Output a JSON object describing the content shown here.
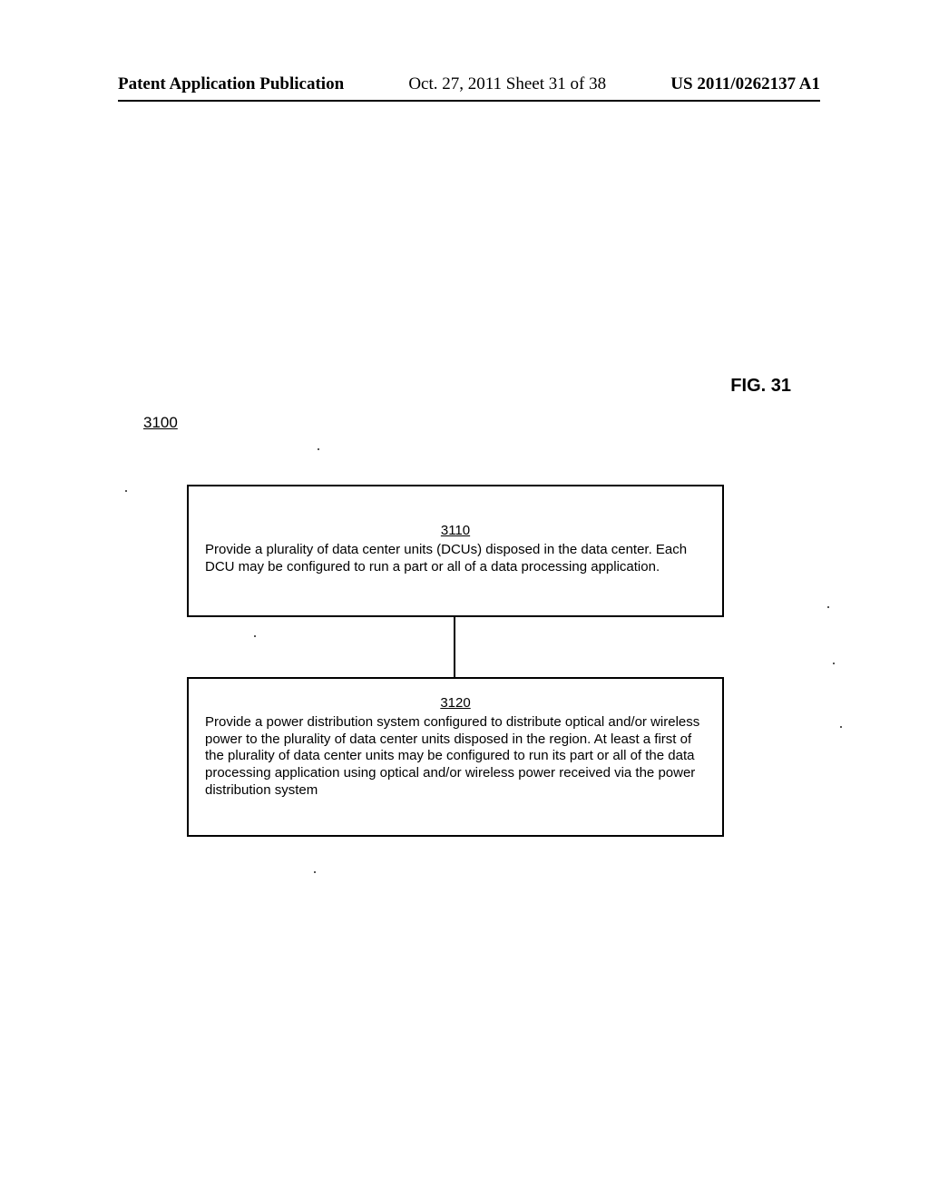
{
  "header": {
    "left": "Patent Application Publication",
    "center": "Oct. 27, 2011  Sheet 31 of 38",
    "right": "US 2011/0262137 A1"
  },
  "figure": {
    "label": "FIG. 31",
    "flowchart_number": "3100",
    "box1": {
      "number": "3110",
      "text": "Provide a plurality of data center units (DCUs) disposed in the  data center.  Each DCU may be configured to run a part or all of a data processing application."
    },
    "box2": {
      "number": "3120",
      "text": "Provide a power distribution system configured to distribute optical and/or wireless power to the plurality of data center units disposed in the region.  At least a first of the plurality of data center units may be configured to run its part or all of the data processing application using optical and/or wireless power received via the power distribution system"
    }
  }
}
